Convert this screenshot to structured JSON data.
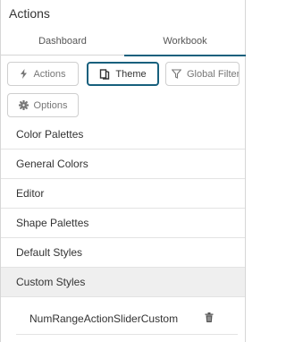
{
  "panel": {
    "title": "Actions"
  },
  "tabs": [
    {
      "label": "Dashboard",
      "active": false
    },
    {
      "label": "Workbook",
      "active": true
    }
  ],
  "toolbar": {
    "actions_label": "Actions",
    "theme_label": "Theme",
    "global_filter_label": "Global Filter",
    "options_label": "Options"
  },
  "menu": {
    "items": [
      "Color Palettes",
      "General Colors",
      "Editor",
      "Shape Palettes",
      "Default Styles",
      "Custom Styles"
    ],
    "selected": "Custom Styles"
  },
  "custom_styles": {
    "items": [
      {
        "label": "NumRangeActionSliderCustom"
      }
    ]
  },
  "colors": {
    "accent": "#17607d",
    "selected_bg": "#efefef",
    "divider": "#e3e3e3"
  },
  "icons": {
    "actions": "lightning-icon",
    "theme": "book-icon",
    "global_filter": "filter-icon",
    "options": "gear-icon",
    "delete": "trash-icon"
  }
}
